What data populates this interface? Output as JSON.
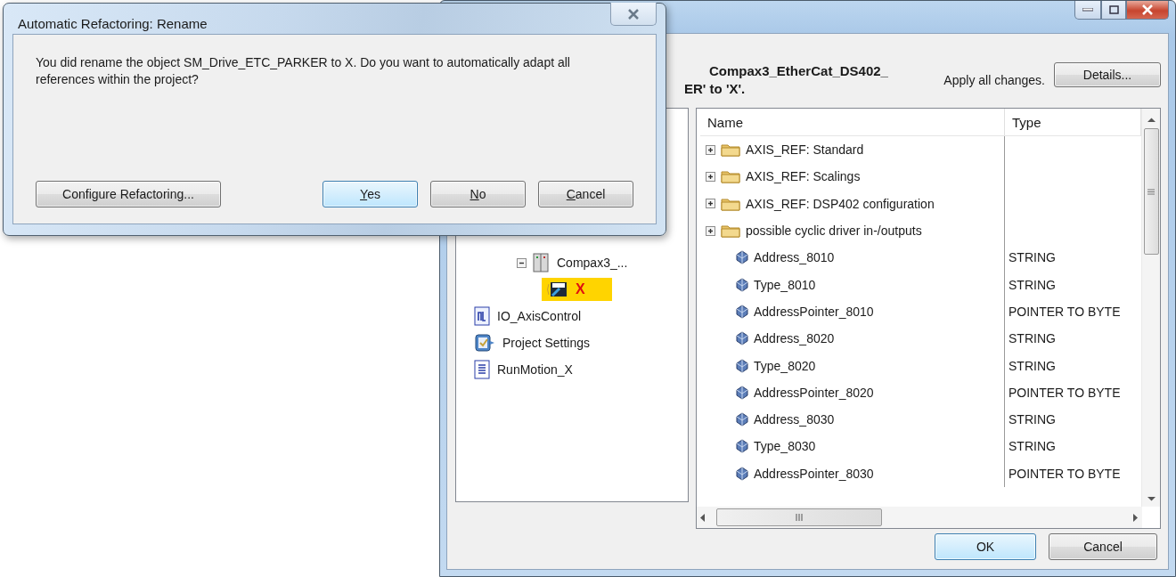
{
  "back_window": {
    "header": {
      "lines": [
        "Compax3_EtherCat_DS402_",
        "ER' to 'X'."
      ],
      "apply_text": "Apply all changes.",
      "details_button": "Details..."
    },
    "tree": {
      "items": [
        {
          "label": "Compax3_...",
          "kind": "device",
          "expanded": true,
          "selected": false,
          "children": [
            {
              "label": "X",
              "kind": "drive",
              "selected": true
            }
          ]
        },
        {
          "label": "IO_AxisControl",
          "kind": "io",
          "selected": false
        },
        {
          "label": "Project Settings",
          "kind": "settings",
          "selected": false
        },
        {
          "label": "RunMotion_X",
          "kind": "program",
          "selected": false
        }
      ]
    },
    "grid": {
      "columns": [
        "Name",
        "Type"
      ],
      "rows": [
        {
          "kind": "folder",
          "name": "AXIS_REF: Standard",
          "expanded": false
        },
        {
          "kind": "folder",
          "name": "AXIS_REF: Scalings",
          "expanded": false
        },
        {
          "kind": "folder",
          "name": "AXIS_REF: DSP402 configuration",
          "expanded": false
        },
        {
          "kind": "folder",
          "name": "possible cyclic driver in-/outputs",
          "expanded": false
        },
        {
          "kind": "variable",
          "name": "Address_8010",
          "type": "STRING"
        },
        {
          "kind": "variable",
          "name": "Type_8010",
          "type": "STRING"
        },
        {
          "kind": "variable",
          "name": "AddressPointer_8010",
          "type": "POINTER TO BYTE"
        },
        {
          "kind": "variable",
          "name": "Address_8020",
          "type": "STRING"
        },
        {
          "kind": "variable",
          "name": "Type_8020",
          "type": "STRING"
        },
        {
          "kind": "variable",
          "name": "AddressPointer_8020",
          "type": "POINTER TO BYTE"
        },
        {
          "kind": "variable",
          "name": "Address_8030",
          "type": "STRING"
        },
        {
          "kind": "variable",
          "name": "Type_8030",
          "type": "STRING"
        },
        {
          "kind": "variable",
          "name": "AddressPointer_8030",
          "type": "POINTER TO BYTE"
        }
      ]
    },
    "buttons": [
      {
        "label": "OK",
        "default": true
      },
      {
        "label": "Cancel",
        "default": false
      }
    ]
  },
  "dialog": {
    "title": "Automatic Refactoring: Rename",
    "message": "You did rename the object SM_Drive_ETC_PARKER to X. Do you want to automatically adapt all references within the project?",
    "configure_button": "Configure Refactoring...",
    "buttons": [
      {
        "label": "Yes",
        "default": true,
        "mnemonic_underlined": true
      },
      {
        "label": "No",
        "default": false,
        "mnemonic_underlined": true
      },
      {
        "label": "Cancel",
        "default": false,
        "mnemonic_underlined": true
      }
    ]
  }
}
